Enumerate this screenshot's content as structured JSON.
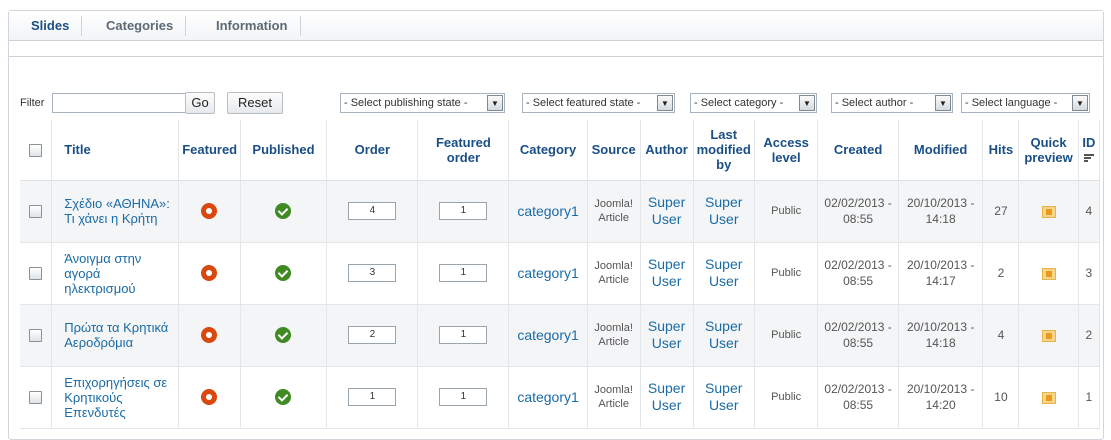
{
  "tabs": [
    "Slides",
    "Categories",
    "Information"
  ],
  "filter": {
    "label": "Filter",
    "value": "",
    "go_label": "Go",
    "reset_label": "Reset",
    "selects": [
      "- Select publishing state -",
      "- Select featured state -",
      "- Select category -",
      "- Select author -",
      "- Select language -"
    ]
  },
  "columns": {
    "title": "Title",
    "featured": "Featured",
    "published": "Published",
    "order": "Order",
    "featured_order": "Featured order",
    "category": "Category",
    "source": "Source",
    "author": "Author",
    "last_modified_by": "Last modified by",
    "access_level": "Access level",
    "created": "Created",
    "modified": "Modified",
    "hits": "Hits",
    "quick_preview": "Quick preview",
    "id": "ID"
  },
  "rows": [
    {
      "title": "Σχέδιο «ΑΘΗΝΑ»: Τι χάνει η Κρήτη",
      "order": "4",
      "featured_order": "1",
      "category": "category1",
      "source": "Joomla! Article",
      "author": "Super User",
      "modified_by": "Super User",
      "access": "Public",
      "created": "02/02/2013 - 08:55",
      "modified": "20/10/2013 - 14:18",
      "hits": "27",
      "id": "4"
    },
    {
      "title": "Άνοιγμα στην αγορά ηλεκτρισμού",
      "order": "3",
      "featured_order": "1",
      "category": "category1",
      "source": "Joomla! Article",
      "author": "Super User",
      "modified_by": "Super User",
      "access": "Public",
      "created": "02/02/2013 - 08:55",
      "modified": "20/10/2013 - 14:17",
      "hits": "2",
      "id": "3"
    },
    {
      "title": "Πρώτα τα Κρητικά Αεροδρόμια",
      "order": "2",
      "featured_order": "1",
      "category": "category1",
      "source": "Joomla! Article",
      "author": "Super User",
      "modified_by": "Super User",
      "access": "Public",
      "created": "02/02/2013 - 08:55",
      "modified": "20/10/2013 - 14:18",
      "hits": "4",
      "id": "2"
    },
    {
      "title": "Επιχορηγήσεις σε Κρητικούς Επενδυτές",
      "order": "1",
      "featured_order": "1",
      "category": "category1",
      "source": "Joomla! Article",
      "author": "Super User",
      "modified_by": "Super User",
      "access": "Public",
      "created": "02/02/2013 - 08:55",
      "modified": "20/10/2013 - 14:20",
      "hits": "10",
      "id": "1"
    }
  ],
  "colors": {
    "link": "#1a6ba6",
    "header": "#1a4f86",
    "featured": "#d9480f",
    "published": "#3f8a22"
  }
}
